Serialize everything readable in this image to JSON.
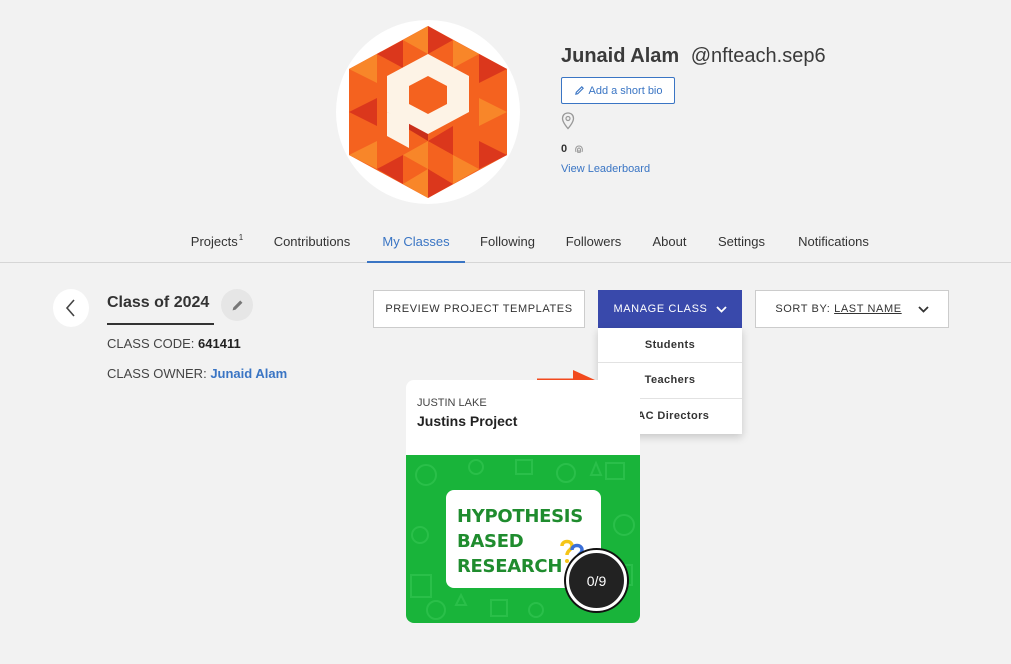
{
  "profile": {
    "name": "Junaid Alam",
    "handle": "@nfteach.sep6",
    "add_bio_label": "Add a short bio",
    "score": "0",
    "leaderboard_link": "View Leaderboard"
  },
  "tabs": [
    {
      "label": "Projects",
      "badge": "1"
    },
    {
      "label": "Contributions"
    },
    {
      "label": "My Classes",
      "active": true
    },
    {
      "label": "Following"
    },
    {
      "label": "Followers"
    },
    {
      "label": "About"
    },
    {
      "label": "Settings"
    },
    {
      "label": "Notifications"
    }
  ],
  "class": {
    "title": "Class of 2024",
    "code_label": "CLASS CODE:",
    "code_value": "641411",
    "owner_label": "CLASS OWNER:",
    "owner_value": "Junaid Alam"
  },
  "toolbar": {
    "preview_label": "PREVIEW PROJECT TEMPLATES",
    "manage_label": "MANAGE CLASS",
    "sort_label": "SORT BY:",
    "sort_value": "LAST NAME"
  },
  "manage_menu": {
    "items": [
      "Students",
      "Teachers",
      "JAC Directors"
    ]
  },
  "project_card": {
    "author": "JUSTIN LAKE",
    "title": "Justins Project",
    "image_lines": [
      "HYPOTHESIS",
      "BASED",
      "RESEARCH"
    ],
    "progress": "0/9"
  },
  "colors": {
    "accent": "#3a75c4",
    "manage_button": "#3949ab",
    "annotation_arrow": "#f24a1e",
    "card_image_bg": "#19b43a"
  }
}
